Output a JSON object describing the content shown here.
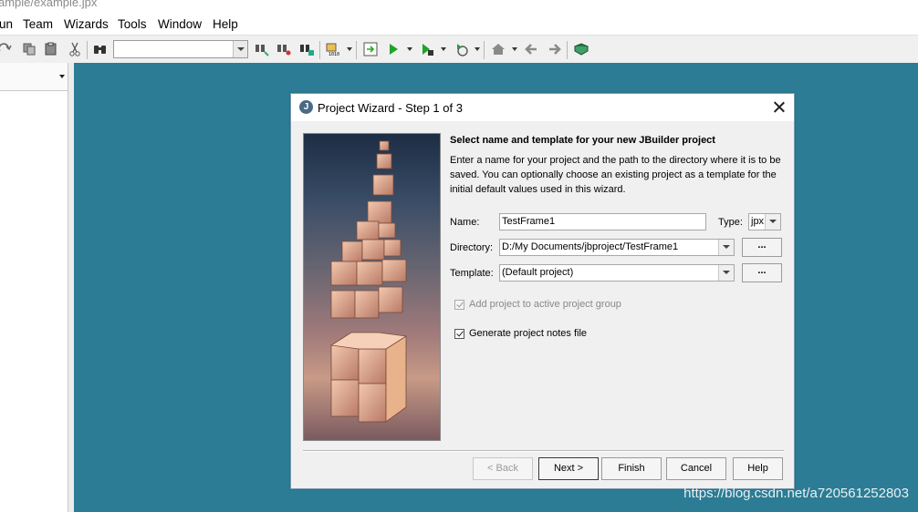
{
  "window": {
    "title_fragment": "ample/example.jpx"
  },
  "menu": [
    "un",
    "Team",
    "Wizards",
    "Tools",
    "Window",
    "Help"
  ],
  "toolbar": {
    "search_combo_value": ""
  },
  "dialog": {
    "title": "Project Wizard - Step 1 of 3",
    "heading": "Select name and template for your new JBuilder project",
    "description": "Enter a name for your project and the path to the directory where it is to be saved. You can optionally choose an existing project as a template for the initial default values used in this wizard.",
    "name_label": "Name:",
    "name_value": "TestFrame1",
    "type_label": "Type:",
    "type_value": "jpx",
    "directory_label": "Directory:",
    "directory_value": "D:/My Documents/jbproject/TestFrame1",
    "template_label": "Template:",
    "template_value": "(Default project)",
    "browse_label": "...",
    "add_to_group_label": "Add project to active project group",
    "add_to_group_checked": true,
    "add_to_group_enabled": false,
    "notes_label": "Generate project notes file",
    "notes_checked": true,
    "buttons": {
      "back": "< Back",
      "next": "Next >",
      "finish": "Finish",
      "cancel": "Cancel",
      "help": "Help"
    }
  },
  "watermark": "https://blog.csdn.net/a720561252803",
  "colors": {
    "workspace": "#2b7c94",
    "dialog_bg": "#f0f0f0"
  }
}
